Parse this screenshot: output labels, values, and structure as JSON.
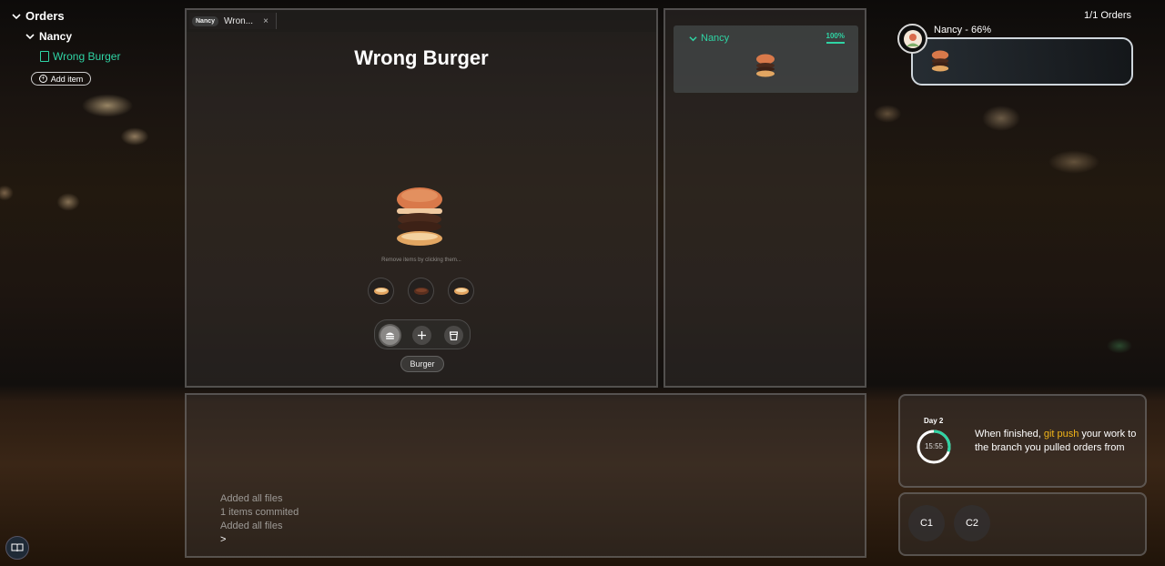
{
  "tree": {
    "root_label": "Orders",
    "customer_label": "Nancy",
    "file_label": "Wrong Burger",
    "add_item_label": "Add item"
  },
  "editor": {
    "tab_badge": "Nancy",
    "tab_label": "Wron...",
    "tab_close": "×",
    "title": "Wrong Burger",
    "hint": "Remove items by clicking them...",
    "ingredients": [
      "bun-bottom",
      "patty",
      "bun-bottom"
    ],
    "tools": [
      "burger-icon",
      "plus-icon",
      "cup-icon"
    ],
    "active_tool_label": "Burger"
  },
  "preview": {
    "customer_label": "Nancy",
    "percent": "100%"
  },
  "orders": {
    "count_label": "1/1 Orders",
    "order_title": "Nancy - 66%"
  },
  "status": {
    "day_label": "Day 2",
    "timer": "15:55",
    "timer_progress": 0.3,
    "message_prefix": "When finished, ",
    "message_highlight": "git push",
    "message_suffix": " your work to the branch you pulled orders from"
  },
  "commits": [
    "C1",
    "C2"
  ],
  "terminal": {
    "lines": [
      "Added all files",
      "1 items commited",
      "Added all files"
    ],
    "prompt": ">"
  },
  "colors": {
    "accent": "#2fd4a4",
    "highlight": "#f0b419"
  }
}
